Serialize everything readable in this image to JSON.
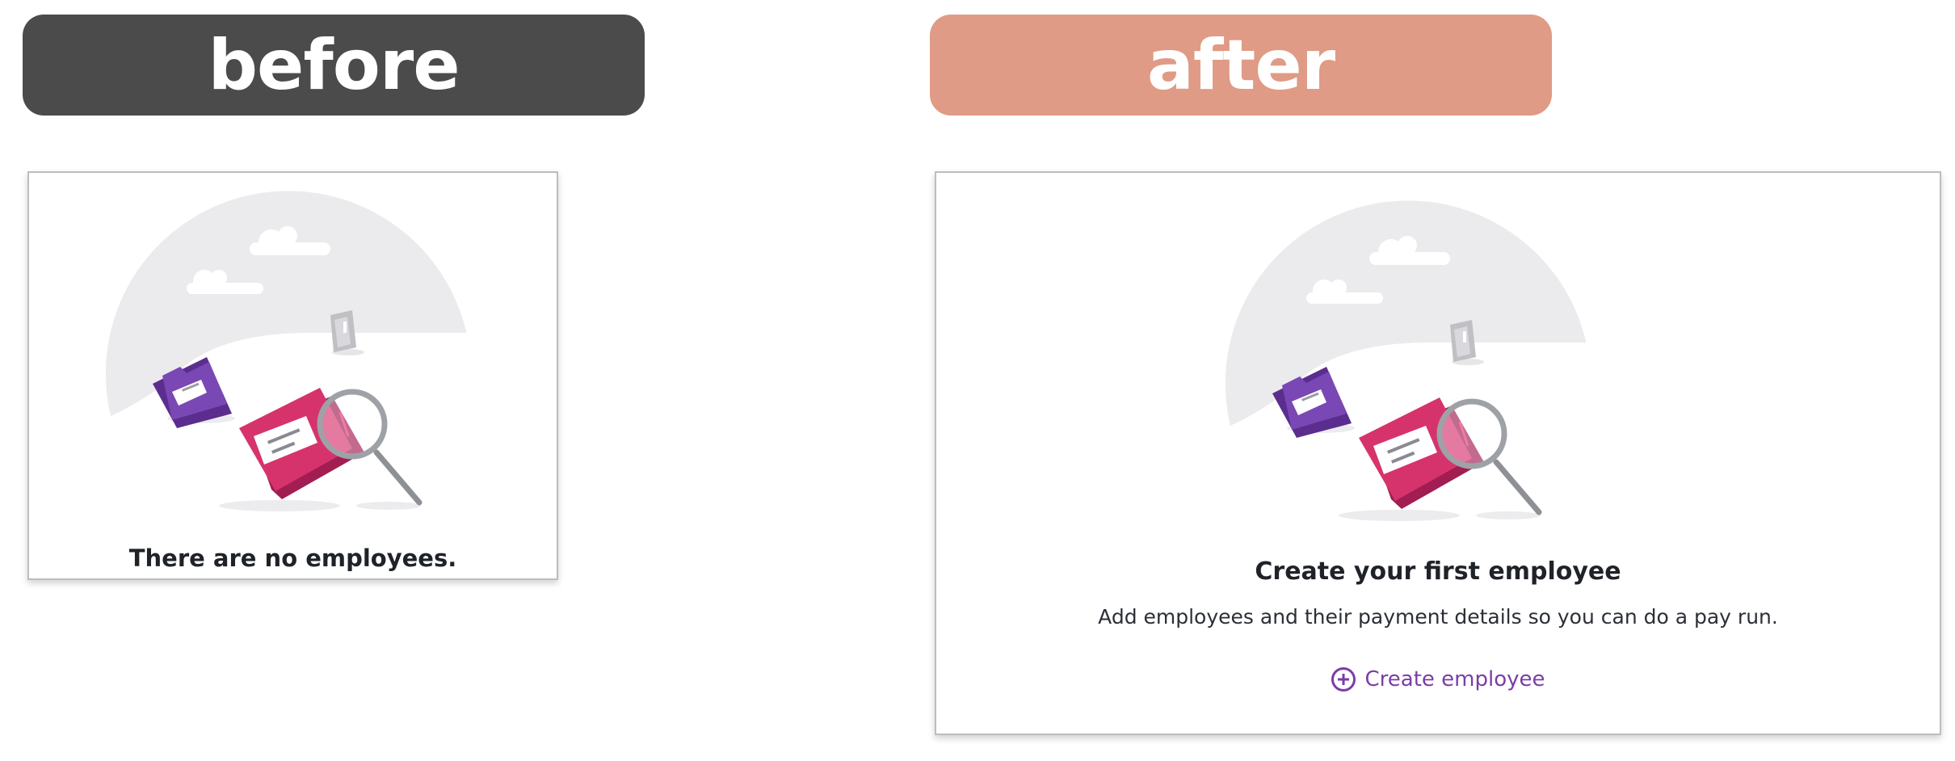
{
  "labels": {
    "before": "before",
    "after": "after"
  },
  "before_card": {
    "message": "There are no employees."
  },
  "after_card": {
    "heading": "Create your first employee",
    "description": "Add employees and their payment details so you can do a pay run.",
    "create_link": "Create employee",
    "create_icon": "plus-circle-icon"
  },
  "colors": {
    "before_pill": "#4b4b4b",
    "after_pill": "#df9b85",
    "link": "#7a3ea7",
    "folder_pink": "#d6336c",
    "folder_purple": "#6b3fa0"
  },
  "illustration": {
    "icon": "empty-folder-search-illustration"
  }
}
